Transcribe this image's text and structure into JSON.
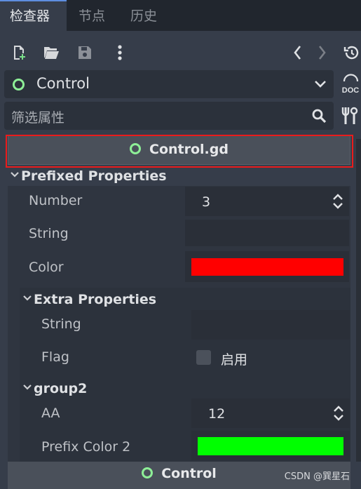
{
  "tabs": [
    {
      "label": "检查器",
      "active": true
    },
    {
      "label": "节点",
      "active": false
    },
    {
      "label": "历史",
      "active": false
    }
  ],
  "toolbar": {
    "icons": [
      "new-resource-icon",
      "open-folder-icon",
      "save-icon",
      "more-vertical-icon",
      "back-icon",
      "forward-icon",
      "history-icon"
    ]
  },
  "node_selector": {
    "value": "Control"
  },
  "doc_button": {
    "label": "DOC"
  },
  "filter": {
    "placeholder": "筛选属性"
  },
  "script_header": {
    "label": "Control.gd"
  },
  "groups": {
    "prefixed": {
      "title": "Prefixed Properties",
      "number": {
        "label": "Number",
        "value": "3"
      },
      "string": {
        "label": "String",
        "value": ""
      },
      "color": {
        "label": "Color",
        "value": "#ff0000"
      }
    },
    "extra": {
      "title": "Extra Properties",
      "string": {
        "label": "String",
        "value": ""
      },
      "flag": {
        "label": "Flag",
        "checkbox_label": "启用",
        "checked": false
      }
    },
    "group2": {
      "title": "group2",
      "aa": {
        "label": "AA",
        "value": "12"
      },
      "prefix_color_2": {
        "label": "Prefix Color 2",
        "value": "#00ff00"
      }
    }
  },
  "footer": {
    "label": "Control"
  },
  "watermark": "CSDN @巽星石",
  "colors": {
    "accent": "#5e8ee0",
    "node_circle": "#8eef97",
    "highlight_border": "#ea1c1c"
  }
}
